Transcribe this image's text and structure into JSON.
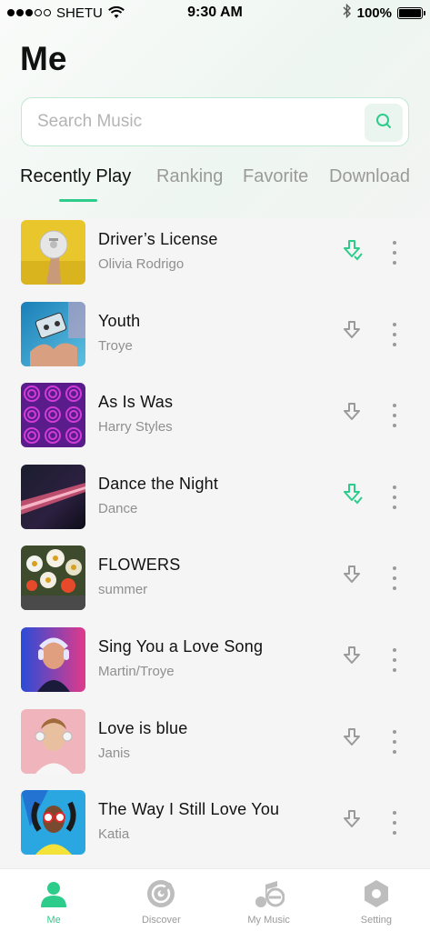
{
  "status_bar": {
    "carrier": "SHETU",
    "time": "9:30 AM",
    "battery": "100%"
  },
  "page": {
    "title": "Me"
  },
  "search": {
    "placeholder": "Search Music"
  },
  "tabs": [
    {
      "label": "Recently Play",
      "active": true
    },
    {
      "label": "Ranking",
      "active": false
    },
    {
      "label": "Favorite",
      "active": false
    },
    {
      "label": "Download",
      "active": false
    }
  ],
  "songs": [
    {
      "title": "Driver’s License",
      "artist": "Olivia Rodrigo",
      "downloaded": true
    },
    {
      "title": "Youth",
      "artist": "Troye",
      "downloaded": false
    },
    {
      "title": "As Is Was",
      "artist": "Harry Styles",
      "downloaded": false
    },
    {
      "title": "Dance the Night",
      "artist": "Dance",
      "downloaded": true
    },
    {
      "title": "FLOWERS",
      "artist": "summer",
      "downloaded": false
    },
    {
      "title": "Sing You a Love Song",
      "artist": "Martin/Troye",
      "downloaded": false
    },
    {
      "title": "Love is blue",
      "artist": "Janis",
      "downloaded": false
    },
    {
      "title": "The Way I Still Love You",
      "artist": "Katia",
      "downloaded": false
    }
  ],
  "tab_bar": [
    {
      "label": "Me",
      "icon": "person-icon",
      "active": true
    },
    {
      "label": "Discover",
      "icon": "disc-icon",
      "active": false
    },
    {
      "label": "My Music",
      "icon": "music-note-icon",
      "active": false
    },
    {
      "label": "Setting",
      "icon": "hexagon-settings-icon",
      "active": false
    }
  ],
  "colors": {
    "accent": "#2ecc8a",
    "inactive": "#9a9a9a",
    "background": "#f5f5f5"
  }
}
